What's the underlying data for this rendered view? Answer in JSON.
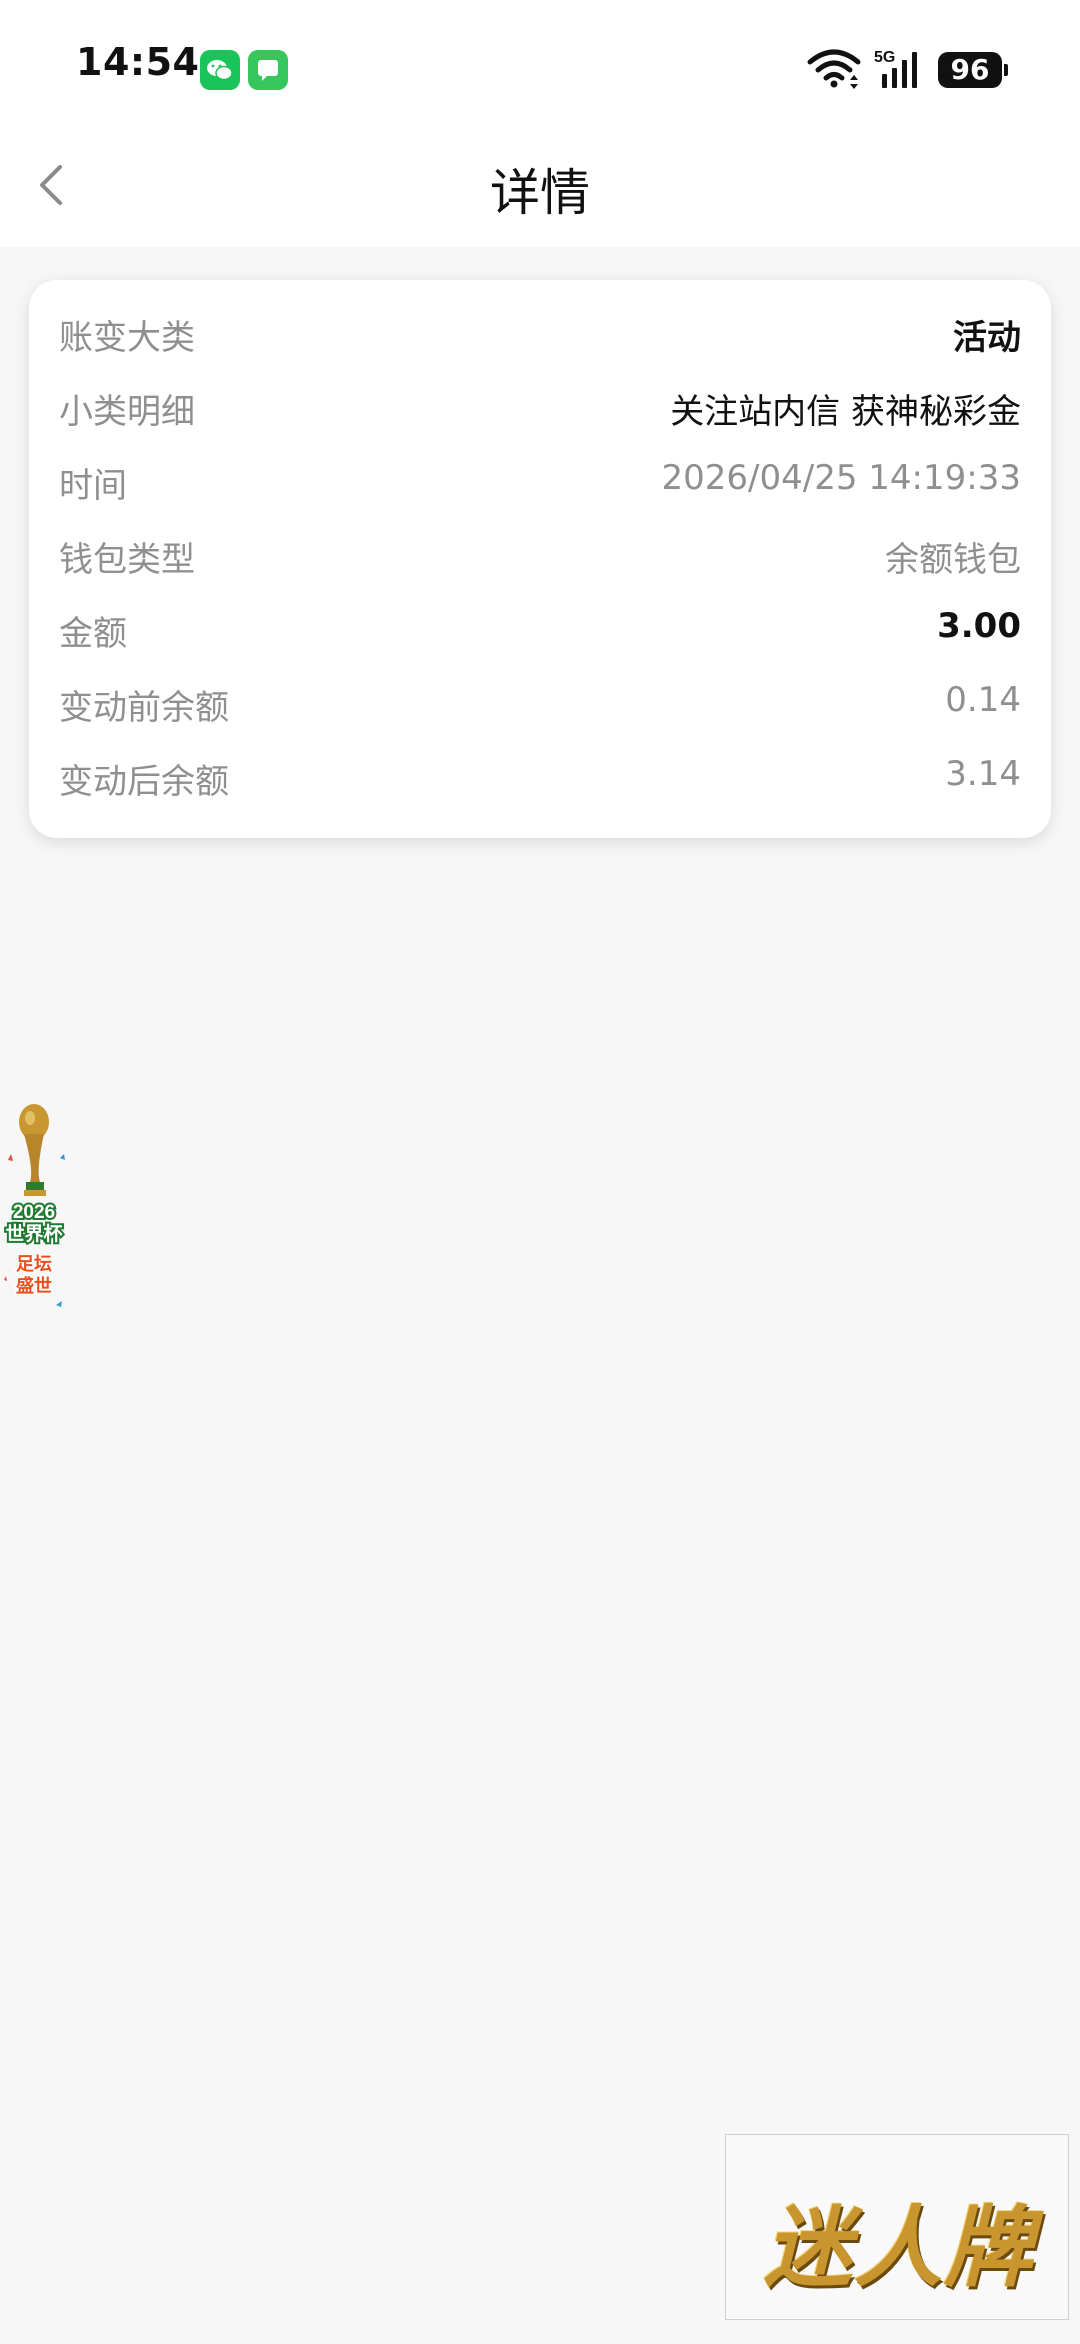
{
  "status_bar": {
    "time": "14:54",
    "battery": "96",
    "network": "5G"
  },
  "header": {
    "title": "详情"
  },
  "details": {
    "rows": [
      {
        "label": "账变大类",
        "value": "活动",
        "style": "bold"
      },
      {
        "label": "小类明细",
        "value": "关注站内信 获神秘彩金",
        "style": "dark"
      },
      {
        "label": "时间",
        "value": "2026/04/25 14:19:33",
        "style": "muted"
      },
      {
        "label": "钱包类型",
        "value": "余额钱包",
        "style": "muted"
      },
      {
        "label": "金额",
        "value": "3.00",
        "style": "bold"
      },
      {
        "label": "变动前余额",
        "value": "0.14",
        "style": "muted"
      },
      {
        "label": "变动后余额",
        "value": "3.14",
        "style": "muted"
      }
    ]
  },
  "promo": {
    "year": "2026",
    "line1": "世界杯",
    "line2a": "足坛",
    "line2b": "盛世"
  },
  "brand": {
    "text": "迷人牌"
  },
  "colors": {
    "label": "#8f8f8f",
    "value_dark": "#111111",
    "background": "#f7f7f7",
    "card": "#ffffff"
  }
}
